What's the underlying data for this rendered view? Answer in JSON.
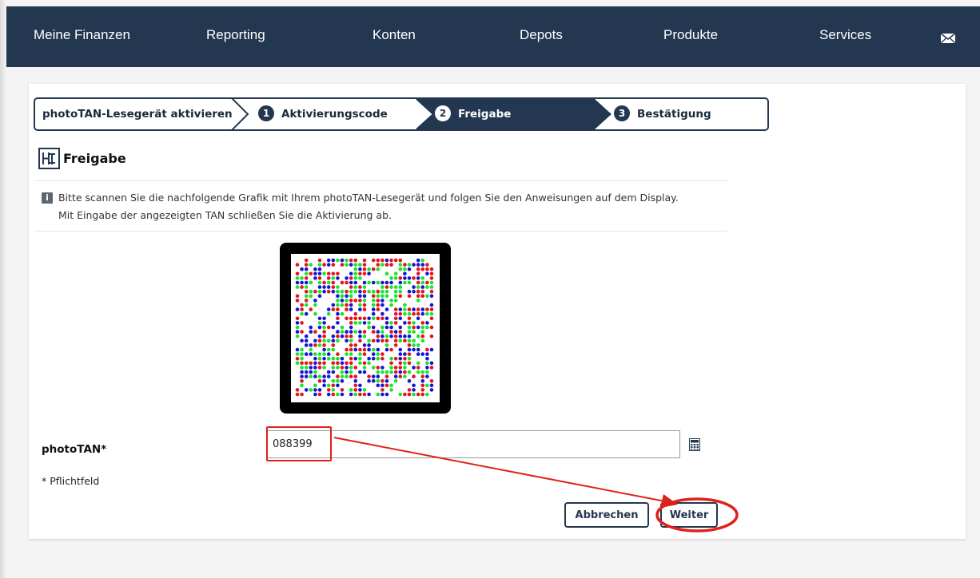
{
  "nav": {
    "items": [
      {
        "label": "Meine Finanzen"
      },
      {
        "label": "Reporting"
      },
      {
        "label": "Konten"
      },
      {
        "label": "Depots"
      },
      {
        "label": "Produkte"
      },
      {
        "label": "Services"
      }
    ],
    "mail_icon": "envelope-icon"
  },
  "stepper": {
    "steps": [
      {
        "label": "photoTAN-Lesegerät aktivieren",
        "number": ""
      },
      {
        "label": "Aktivierungscode",
        "number": "1"
      },
      {
        "label": "Freigabe",
        "number": "2",
        "active": true
      },
      {
        "label": "Bestätigung",
        "number": "3"
      }
    ]
  },
  "heading": {
    "title": "Freigabe",
    "icon": "bank-logo-icon"
  },
  "info": {
    "line1": "Bitte scannen Sie die nachfolgende Grafik mit Ihrem photoTAN-Lesegerät und folgen Sie den Anweisungen auf dem Display.",
    "line2": "Mit Eingabe der angezeigten TAN schließen Sie die Aktivierung ab.",
    "icon": "info-icon"
  },
  "form": {
    "phototan_label": "photoTAN*",
    "phototan_value": "088399",
    "calculator_icon": "calculator-icon",
    "required_note": "* Pflichtfeld",
    "cancel_label": "Abbrechen",
    "next_label": "Weiter"
  },
  "colors": {
    "navy": "#243750",
    "annotation_red": "#e0211b",
    "dot_red": "#e4141e",
    "dot_green": "#19e52a",
    "dot_blue": "#1515d6"
  }
}
